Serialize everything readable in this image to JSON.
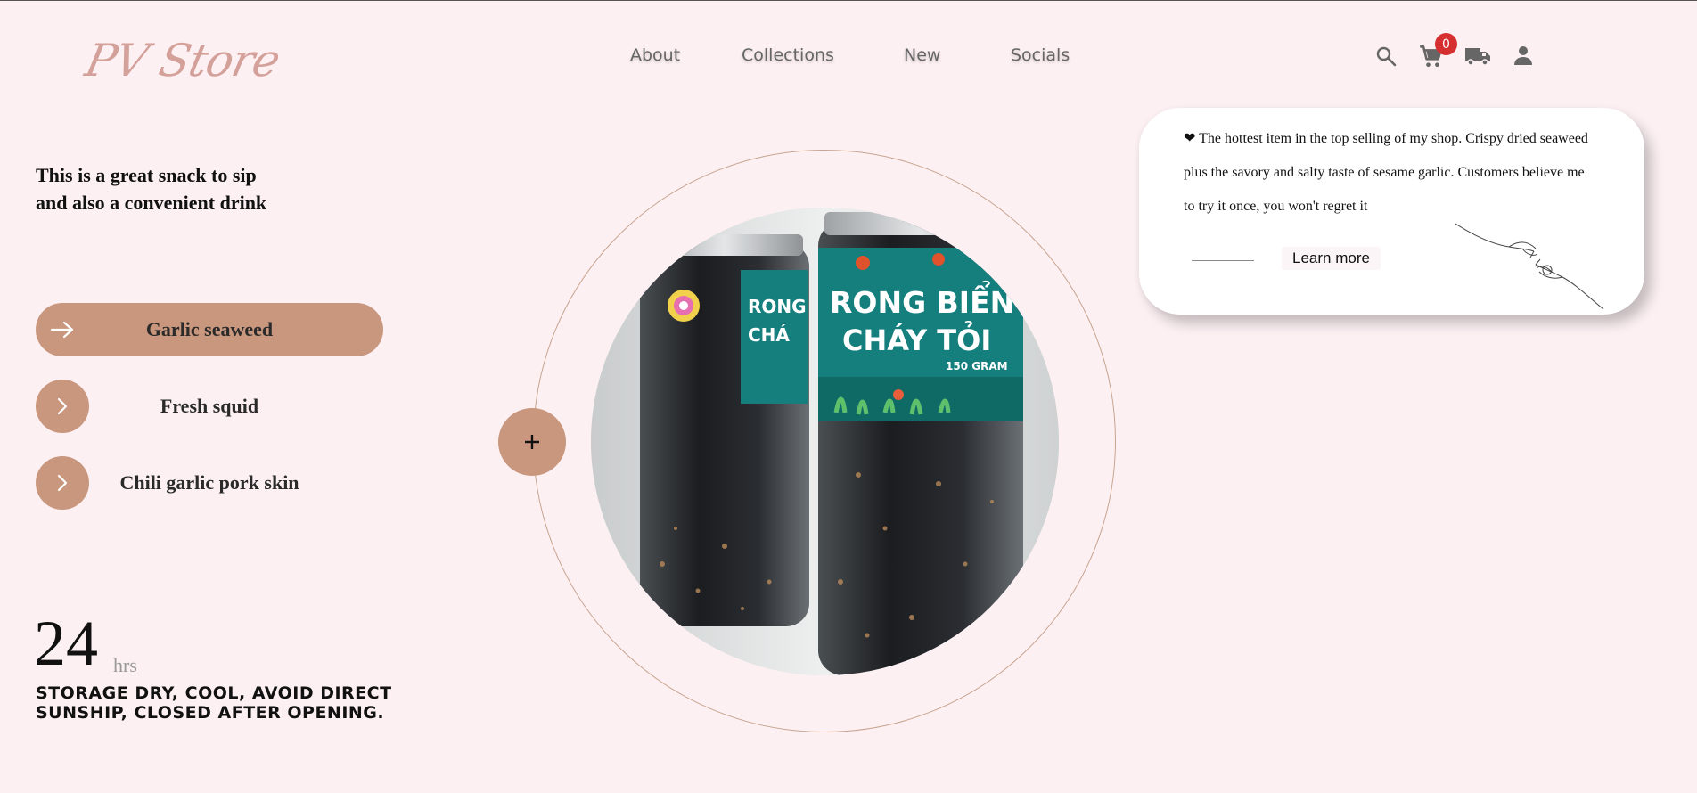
{
  "brand": {
    "logo_text": "PV Store"
  },
  "nav": {
    "items": [
      "About",
      "Collections",
      "New",
      "Socials"
    ]
  },
  "header_icons": {
    "search": "search-icon",
    "cart": "cart-icon",
    "shipping": "truck-icon",
    "account": "user-icon",
    "cart_count": "0"
  },
  "intro": {
    "line1": "This is a great snack to sip",
    "line2": "and also a convenient drink"
  },
  "menu": {
    "items": [
      {
        "label": "Garlic seaweed",
        "active": true
      },
      {
        "label": "Fresh squid",
        "active": false
      },
      {
        "label": "Chili garlic pork skin",
        "active": false
      }
    ]
  },
  "stat": {
    "number": "24",
    "unit": "hrs",
    "note": "STORAGE DRY, COOL, AVOID DIRECT SUNSHIP, CLOSED AFTER OPENING."
  },
  "product": {
    "label_line1": "RONG BIỂN",
    "label_line2": "CHÁY TỎI",
    "label_weight": "150 GRAM",
    "side_label_1": "RONG",
    "side_label_2": "CHÁ"
  },
  "card": {
    "text": "❤ The hottest item in the top selling of my shop. Crispy dried seaweed plus the savory and salty taste of sesame garlic. Customers believe me to try it once, you won't regret it",
    "cta": "Learn more"
  },
  "colors": {
    "background": "#fcf0f3",
    "accent": "#c9977d",
    "logo": "#d4a09a",
    "badge": "#d62f2f"
  }
}
